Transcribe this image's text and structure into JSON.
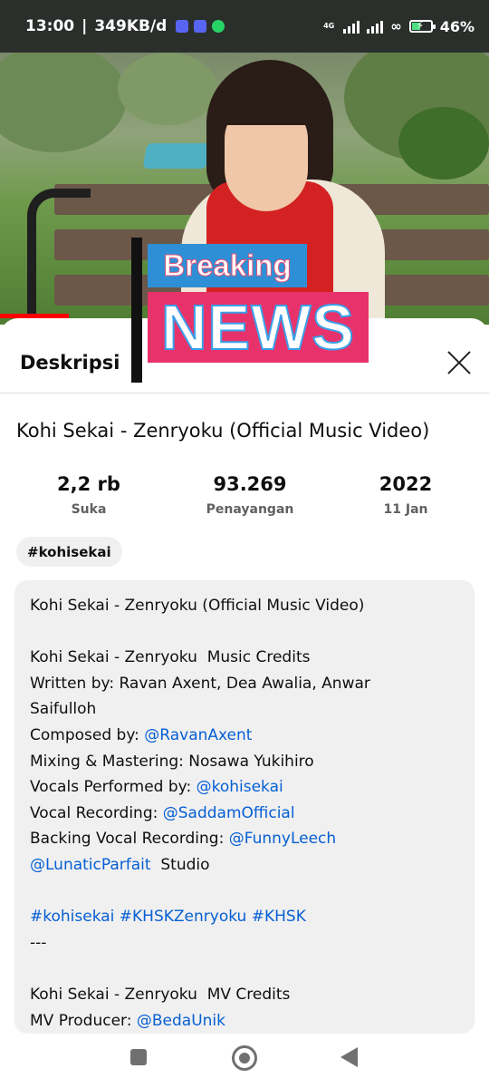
{
  "status_bar": {
    "time": "13:00",
    "net_speed": "349KB/d",
    "network_type": "4G",
    "battery_percent": "46%",
    "battery_level": 0.46,
    "app_icons": [
      "discord-icon",
      "discord-icon",
      "whatsapp-icon"
    ]
  },
  "overlay": {
    "breaking": "Breaking",
    "news": "NEWS"
  },
  "player": {
    "progress_fraction": 0.14
  },
  "sheet": {
    "title": "Deskripsi",
    "close_icon": "close-icon"
  },
  "video": {
    "title": "Kohi Sekai - Zenryoku (Official Music Video)",
    "stats": [
      {
        "value": "2,2 rb",
        "label": "Suka"
      },
      {
        "value": "93.269",
        "label": "Penayangan"
      },
      {
        "value": "2022",
        "label": "11 Jan"
      }
    ],
    "hashtag": "#kohisekai"
  },
  "description": {
    "lines": [
      [
        {
          "t": "Kohi Sekai - Zenryoku (Official Music Video)"
        }
      ],
      [],
      [
        {
          "t": "Kohi Sekai - Zenryoku  Music Credits"
        }
      ],
      [
        {
          "t": "Written by: Ravan Axent, Dea Awalia, Anwar"
        }
      ],
      [
        {
          "t": "Saifulloh"
        }
      ],
      [
        {
          "t": "Composed by: "
        },
        {
          "t": "@RavanAxent",
          "link": true
        }
      ],
      [
        {
          "t": "Mixing & Mastering: Nosawa Yukihiro"
        }
      ],
      [
        {
          "t": "Vocals Performed by: "
        },
        {
          "t": "@kohisekai",
          "link": true
        }
      ],
      [
        {
          "t": "Vocal Recording: "
        },
        {
          "t": "@SaddamOfficial",
          "link": true
        }
      ],
      [
        {
          "t": "Backing Vocal Recording: "
        },
        {
          "t": "@FunnyLeech",
          "link": true
        }
      ],
      [
        {
          "t": "@LunaticParfait",
          "link": true
        },
        {
          "t": "  Studio"
        }
      ],
      [],
      [
        {
          "t": "#kohisekai #KHSKZenryoku #KHSK",
          "link": true
        }
      ],
      [
        {
          "t": "---"
        }
      ],
      [],
      [
        {
          "t": "Kohi Sekai - Zenryoku  MV Credits"
        }
      ],
      [
        {
          "t": "MV Producer: "
        },
        {
          "t": "@BedaUnik",
          "link": true
        }
      ]
    ]
  },
  "colors": {
    "link": "#065fd4",
    "progress": "#ff0000",
    "breaking_bg": "#2f8fd6",
    "news_bg": "#e8326b"
  },
  "nav": {
    "recents": "square-icon",
    "home": "home-circle-icon",
    "back": "back-triangle-icon"
  }
}
